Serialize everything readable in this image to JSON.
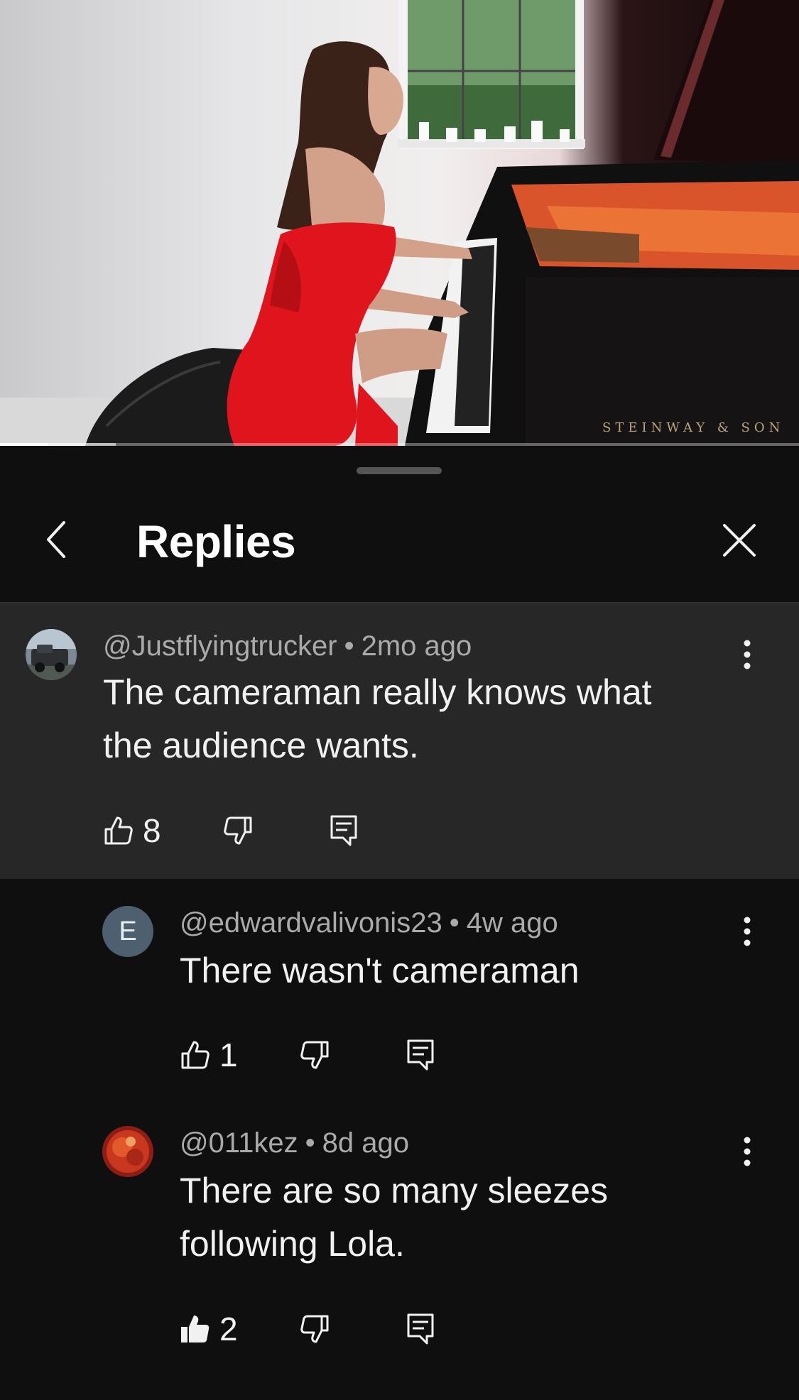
{
  "video": {
    "brand_text": "STEINWAY & SON",
    "progress": {
      "played_fraction": 0.06,
      "buffered_fraction": 0.145
    }
  },
  "sheet": {
    "title": "Replies"
  },
  "parent_comment": {
    "author": "@Justflyingtrucker",
    "time": "2mo ago",
    "separator": "•",
    "text_line1": "The cameraman really knows what",
    "text_line2": "the audience wants.",
    "likes": "8"
  },
  "replies": [
    {
      "author": "@edwardvalivonis23",
      "time": "4w ago",
      "separator": "•",
      "avatar_letter": "E",
      "text_line1": "There wasn't cameraman",
      "likes": "1"
    },
    {
      "author": "@011kez",
      "time": "8d ago",
      "separator": "•",
      "text_line1": "There are so many sleezes",
      "text_line2": "following Lola.",
      "likes": "2",
      "liked": true
    }
  ],
  "icons": {
    "back": "chevron-left-icon",
    "close": "close-icon",
    "like": "thumbs-up-icon",
    "dislike": "thumbs-down-icon",
    "reply": "reply-comment-icon",
    "more": "more-vertical-icon"
  },
  "colors": {
    "sheet_bg": "#0f0f0f",
    "parent_highlight": "#272727",
    "meta_text": "#aaaaaa",
    "primary_text": "#f1f1f1"
  }
}
